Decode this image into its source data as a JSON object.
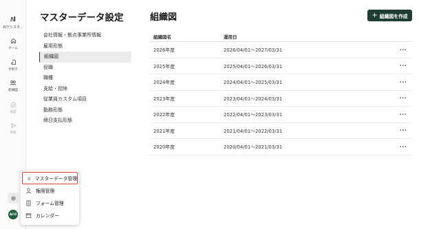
{
  "app": {
    "logo_mark": "ﾊl",
    "logo_name": "AIアシスタ..."
  },
  "rail": {
    "items": [
      {
        "label": "ホーム",
        "icon": "home-icon"
      },
      {
        "label": "手続き",
        "icon": "procedure-icon"
      },
      {
        "label": "組織図",
        "icon": "org-chart-icon"
      },
      {
        "label": "承認",
        "icon": "approval-icon"
      },
      {
        "label": "申請",
        "icon": "send-icon"
      }
    ],
    "settings_icon": "gear-icon",
    "avatar_text": "ACO"
  },
  "sidebar": {
    "title": "マスターデータ設定",
    "items": [
      {
        "label": "会社情報・拠点事業所情報"
      },
      {
        "label": "雇用形態"
      },
      {
        "label": "組織図"
      },
      {
        "label": "役職"
      },
      {
        "label": "職種"
      },
      {
        "label": "支給・控除"
      },
      {
        "label": "従業員カスタム項目"
      },
      {
        "label": "勤務形態"
      },
      {
        "label": "締日支払形態"
      }
    ],
    "active_index": 2
  },
  "main": {
    "title": "組織図",
    "create_button": "組織図を作成",
    "columns": [
      "組織図名",
      "運用日"
    ],
    "rows": [
      {
        "name": "2026年度",
        "period": "2026/04/01〜2027/03/31"
      },
      {
        "name": "2025年度",
        "period": "2025/04/01〜2026/03/31"
      },
      {
        "name": "2024年度",
        "period": "2024/04/01〜2025/03/31"
      },
      {
        "name": "2023年度",
        "period": "2023/04/01〜2024/03/31"
      },
      {
        "name": "2022年度",
        "period": "2022/04/01〜2023/03/31"
      },
      {
        "name": "2021年度",
        "period": "2021/04/01〜2022/03/31"
      },
      {
        "name": "2020年度",
        "period": "2020/04/01〜2021/03/31"
      }
    ],
    "row_menu_glyph": "···"
  },
  "popup": {
    "items": [
      {
        "label": "マスターデータ管理",
        "icon": "document-icon"
      },
      {
        "label": "権限管理",
        "icon": "user-icon"
      },
      {
        "label": "フォーム管理",
        "icon": "form-icon"
      },
      {
        "label": "カレンダー",
        "icon": "calendar-icon"
      }
    ],
    "highlight_color": "#e23b3b"
  },
  "colors": {
    "accent": "#1f3d32",
    "active_bg": "#ebebeb"
  }
}
